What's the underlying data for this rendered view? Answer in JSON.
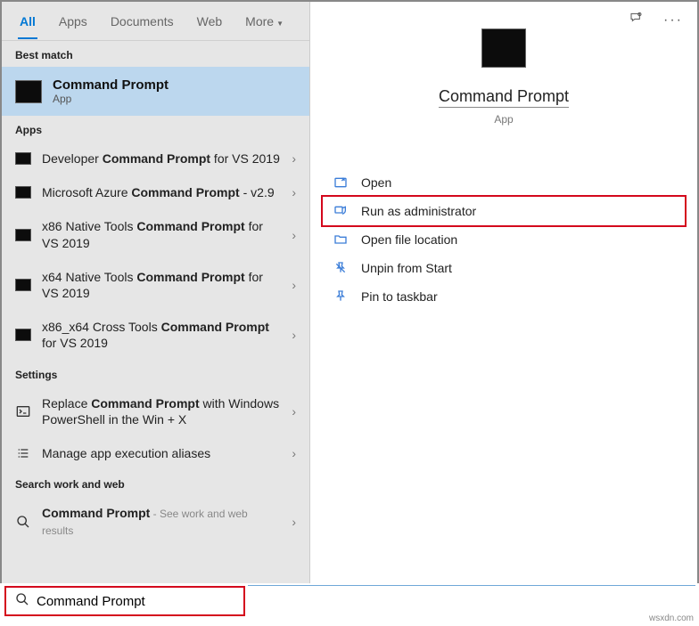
{
  "tabs": {
    "all": "All",
    "apps": "Apps",
    "documents": "Documents",
    "web": "Web",
    "more": "More"
  },
  "sections": {
    "best_match": "Best match",
    "apps": "Apps",
    "settings": "Settings",
    "search_web": "Search work and web"
  },
  "best_match": {
    "title": "Command Prompt",
    "subtitle": "App"
  },
  "apps_list": [
    {
      "pre": "Developer ",
      "bold": "Command Prompt",
      "post": " for VS 2019"
    },
    {
      "pre": "Microsoft Azure ",
      "bold": "Command Prompt",
      "post": " - v2.9"
    },
    {
      "pre": "x86 Native Tools ",
      "bold": "Command Prompt",
      "post": " for VS 2019"
    },
    {
      "pre": "x64 Native Tools ",
      "bold": "Command Prompt",
      "post": " for VS 2019"
    },
    {
      "pre": "x86_x64 Cross Tools ",
      "bold": "Command Prompt",
      "post": " for VS 2019"
    }
  ],
  "settings_list": [
    {
      "pre": "Replace ",
      "bold": "Command Prompt",
      "post": " with Windows PowerShell in the Win + X"
    },
    {
      "text": "Manage app execution aliases"
    }
  ],
  "web_list": [
    {
      "bold": "Command Prompt",
      "hint": " - See work and web results"
    }
  ],
  "preview": {
    "title": "Command Prompt",
    "subtitle": "App"
  },
  "actions": {
    "open": "Open",
    "run_admin": "Run as administrator",
    "file_loc": "Open file location",
    "unpin": "Unpin from Start",
    "pin_taskbar": "Pin to taskbar"
  },
  "search": {
    "value": "Command Prompt"
  },
  "watermark": "wsxdn.com"
}
